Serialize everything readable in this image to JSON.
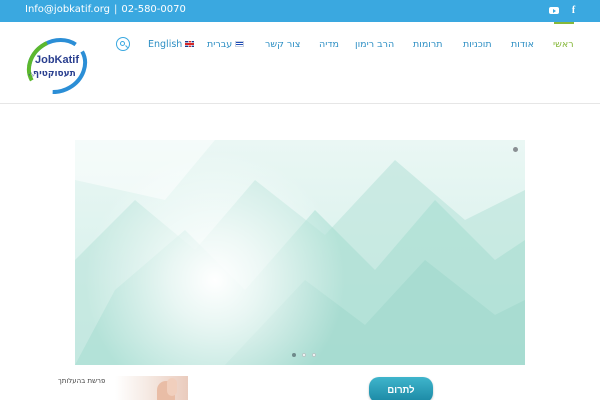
{
  "topbar": {
    "email": "Info@jobkatif.org",
    "separator": "|",
    "phone": "02-580-0070",
    "social": [
      "youtube-icon",
      "facebook-icon"
    ],
    "background_color": "#3aa8e0"
  },
  "logo": {
    "title": "JobKatif",
    "subtitle": "תעסוקטיף",
    "suffix": "ע\"ר"
  },
  "nav": {
    "items": [
      {
        "label": "ראשי",
        "active": true
      },
      {
        "label": "אודות"
      },
      {
        "label": "תוכניות"
      },
      {
        "label": "תרומות"
      },
      {
        "label": "הרב רימון"
      },
      {
        "label": "מדיה"
      },
      {
        "label": "צור קשר"
      },
      {
        "label": "עברית",
        "flag": "il"
      },
      {
        "label": "English",
        "flag": "uk"
      }
    ],
    "link_color": "#2d8fc4",
    "active_color": "#86b83a"
  },
  "slider": {
    "slide_count": 3,
    "active_index": 0
  },
  "footer_area": {
    "donate_label": "לתרום",
    "caption": "פרשת בהעלותך"
  }
}
